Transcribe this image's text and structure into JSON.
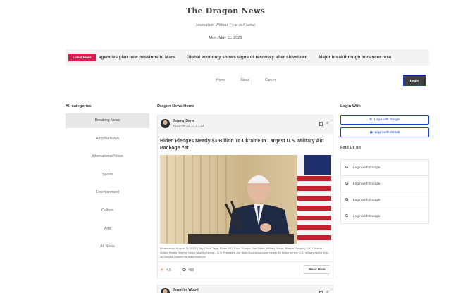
{
  "header": {
    "brand": "The Dragon News",
    "tagline": "Journalism Without Fear or Favour",
    "date": "Mon, May 11, 2026"
  },
  "ticker": {
    "label": "Latest News",
    "items": [
      "agencies plan new missions to Mars",
      "Global economy shows signs of recovery after slowdown",
      "Major breakthrough in cancer rese"
    ]
  },
  "nav": {
    "links": [
      "Home",
      "About",
      "Career"
    ],
    "login_label": "Login"
  },
  "left": {
    "title": "All categories",
    "categories": [
      "Breaking News",
      "Regular News",
      "International News",
      "Sports",
      "Entertainment",
      "Culture",
      "Arts",
      "All News"
    ]
  },
  "middle": {
    "title": "Dragon News Home",
    "card": {
      "author": "Jimmy Dane",
      "date": "2022-08-24 17:27:34",
      "headline": "Biden Pledges Nearly $3 Billion To Ukraine In Largest U.S. Military Aid Package Yet",
      "body": "Wednesday, August 24, 2022 | Tag Cloud Tags: Biden, EU, Euro, Europe, Joe Biden, Military, News, Russia, Security, UK, Ukraine, United States, Worthy News (Worthy News) - U.S. President Joe Biden has announced nearly $3 billion in new U.S. military aid for Kyiv as Ukraine marked its independence",
      "rating": "4.5",
      "views": "488",
      "read_more": "Read More"
    },
    "card2": {
      "author": "Jennifer Wood"
    }
  },
  "right": {
    "login_title": "Login With",
    "google_label": "Login with Google",
    "github_label": "Login with Github",
    "find_title": "Find Us on",
    "find_items": [
      "Login with Google",
      "Login with Google",
      "Login with Google",
      "Login with Google"
    ]
  }
}
